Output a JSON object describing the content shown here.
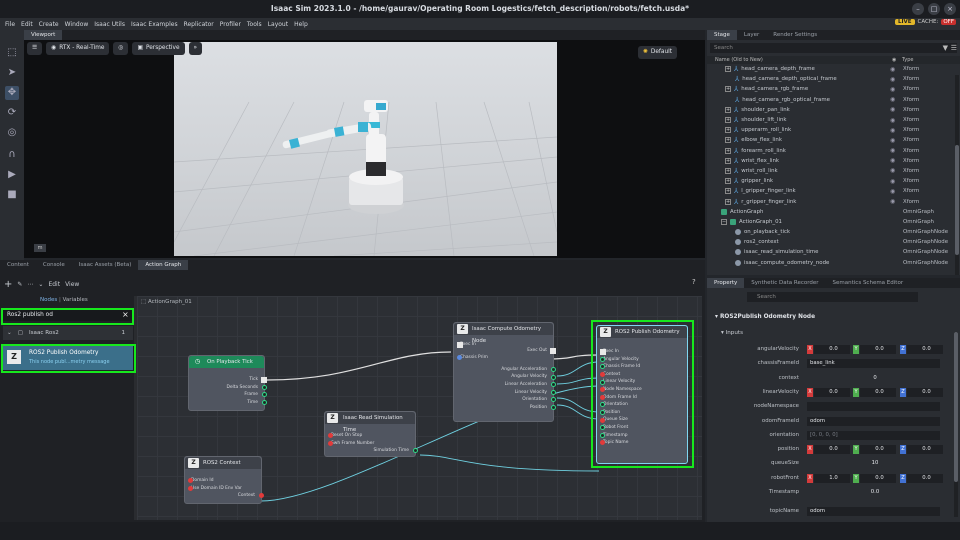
{
  "window": {
    "title": "Isaac Sim 2023.1.0 - /home/gaurav/Operating Room Logestics/fetch_description/robots/fetch.usda*"
  },
  "menu": [
    "File",
    "Edit",
    "Create",
    "Window",
    "Isaac Utils",
    "Isaac Examples",
    "Replicator",
    "Profiler",
    "Tools",
    "Layout",
    "Help"
  ],
  "status": {
    "live": "LIVE",
    "cache_label": "CACHE:",
    "cache_value": "OFF"
  },
  "viewport": {
    "tab": "Viewport",
    "renderer": "RTX - Real-Time",
    "camera": "Perspective",
    "lighting": "Default",
    "badge": "m"
  },
  "stage": {
    "tabs": [
      "Stage",
      "Layer",
      "Render Settings"
    ],
    "search_placeholder": "Search",
    "col_name": "Name (Old to New)",
    "col_type": "Type",
    "rows": [
      {
        "name": "head_camera_depth_frame",
        "type": "Xform",
        "kind": "xf",
        "exp": true,
        "eye": true,
        "indent": 0
      },
      {
        "name": "head_camera_depth_optical_frame",
        "type": "Xform",
        "kind": "xf",
        "exp": false,
        "eye": true,
        "indent": 1
      },
      {
        "name": "head_camera_rgb_frame",
        "type": "Xform",
        "kind": "xf",
        "exp": true,
        "eye": true,
        "indent": 0
      },
      {
        "name": "head_camera_rgb_optical_frame",
        "type": "Xform",
        "kind": "xf",
        "exp": false,
        "eye": true,
        "indent": 1
      },
      {
        "name": "shoulder_pan_link",
        "type": "Xform",
        "kind": "xf",
        "exp": true,
        "eye": true,
        "indent": 0
      },
      {
        "name": "shoulder_lift_link",
        "type": "Xform",
        "kind": "xf",
        "exp": true,
        "eye": true,
        "indent": 0
      },
      {
        "name": "upperarm_roll_link",
        "type": "Xform",
        "kind": "xf",
        "exp": true,
        "eye": true,
        "indent": 0
      },
      {
        "name": "elbow_flex_link",
        "type": "Xform",
        "kind": "xf",
        "exp": true,
        "eye": true,
        "indent": 0
      },
      {
        "name": "forearm_roll_link",
        "type": "Xform",
        "kind": "xf",
        "exp": true,
        "eye": true,
        "indent": 0
      },
      {
        "name": "wrist_flex_link",
        "type": "Xform",
        "kind": "xf",
        "exp": true,
        "eye": true,
        "indent": 0
      },
      {
        "name": "wrist_roll_link",
        "type": "Xform",
        "kind": "xf",
        "exp": true,
        "eye": true,
        "indent": 0
      },
      {
        "name": "gripper_link",
        "type": "Xform",
        "kind": "xf",
        "exp": true,
        "eye": true,
        "indent": 0
      },
      {
        "name": "l_gripper_finger_link",
        "type": "Xform",
        "kind": "xf",
        "exp": true,
        "eye": true,
        "indent": 0
      },
      {
        "name": "r_gripper_finger_link",
        "type": "Xform",
        "kind": "xf",
        "exp": true,
        "eye": true,
        "indent": 0
      },
      {
        "name": "ActionGraph",
        "type": "OmniGraph",
        "kind": "gr",
        "exp": false,
        "eye": false,
        "indent": -1
      },
      {
        "name": "ActionGraph_01",
        "type": "OmniGraph",
        "kind": "gr",
        "exp": true,
        "eye": false,
        "indent": -1
      },
      {
        "name": "on_playback_tick",
        "type": "OmniGraphNode",
        "kind": "nd",
        "exp": false,
        "eye": false,
        "indent": 1
      },
      {
        "name": "ros2_context",
        "type": "OmniGraphNode",
        "kind": "nd",
        "exp": false,
        "eye": false,
        "indent": 1
      },
      {
        "name": "isaac_read_simulation_time",
        "type": "OmniGraphNode",
        "kind": "nd",
        "exp": false,
        "eye": false,
        "indent": 1
      },
      {
        "name": "isaac_compute_odometry_node",
        "type": "OmniGraphNode",
        "kind": "nd",
        "exp": false,
        "eye": false,
        "indent": 1
      }
    ]
  },
  "bottom": {
    "tabs": [
      "Content",
      "Console",
      "Isaac Assets (Beta)",
      "Action Graph"
    ],
    "toolbar": {
      "edit": "Edit",
      "view": "View",
      "help": "?"
    },
    "nodes_tab": "Nodes",
    "variables_tab": "Variables",
    "search_value": "Ros2 publish od",
    "category": "Isaac Ros2",
    "category_count": "1",
    "result_title": "ROS2 Publish Odometry",
    "result_desc": "This node publ...metry message",
    "graph_name": "ActionGraph_01"
  },
  "nodes": {
    "tick": {
      "title": "On Playback Tick",
      "ports": [
        "Tick",
        "Delta Seconds",
        "Frame",
        "Time"
      ]
    },
    "context": {
      "title": "ROS2 Context",
      "inputs": [
        "Domain Id",
        "Use Domain ID Env Var"
      ],
      "outputs": [
        "Context"
      ]
    },
    "simtime": {
      "title": "Isaac Read Simulation Time",
      "inputs": [
        "Reset On Stop",
        "Swh Frame Number"
      ],
      "outputs": [
        "Simulation Time"
      ]
    },
    "odom": {
      "title": "Isaac Compute Odometry Node",
      "inputs": [
        "Exec In",
        "Chassis Prim"
      ],
      "outputs": [
        "Exec Out",
        "Angular Acceleration",
        "Angular Velocity",
        "Linear Acceleration",
        "Linear Velocity",
        "Orientation",
        "Position"
      ]
    },
    "publish": {
      "title": "ROS2 Publish Odometry",
      "inputs": [
        "Exec In",
        "Angular Velocity",
        "Chassis Frame Id",
        "Context",
        "Linear Velocity",
        "Node Namespace",
        "Odom Frame Id",
        "Orientation",
        "Position",
        "Queue Size",
        "Robot Front",
        "Timestamp",
        "Topic Name"
      ]
    }
  },
  "property": {
    "tabs": [
      "Property",
      "Synthetic Data Recorder",
      "Semantics Schema Editor"
    ],
    "search_placeholder": "Search",
    "section": "ROS2Publish Odometry Node",
    "subsection": "Inputs",
    "angularVelocity": {
      "label": "angularVelocity",
      "x": "0.0",
      "y": "0.0",
      "z": "0.0"
    },
    "chassisFrameId": {
      "label": "chassisFrameId",
      "value": "base_link"
    },
    "context": {
      "label": "context",
      "value": "0"
    },
    "linearVelocity": {
      "label": "linearVelocity",
      "x": "0.0",
      "y": "0.0",
      "z": "0.0"
    },
    "nodeNamespace": {
      "label": "nodeNamespace",
      "value": ""
    },
    "odomFrameId": {
      "label": "odomFrameId",
      "value": "odom"
    },
    "orientation": {
      "label": "orientation",
      "value": "[0, 0, 0, 0]"
    },
    "position": {
      "label": "position",
      "x": "0.0",
      "y": "0.0",
      "z": "0.0"
    },
    "queueSize": {
      "label": "queueSize",
      "value": "10"
    },
    "robotFront": {
      "label": "robotFront",
      "x": "1.0",
      "y": "0.0",
      "z": "0.0"
    },
    "timestamp": {
      "label": "Timestamp",
      "value": "0.0"
    },
    "topicName": {
      "label": "topicName",
      "value": "odom"
    }
  },
  "colors": {
    "highlight": "#17e81d",
    "x": "#d43b3b",
    "y": "#4fae4f",
    "z": "#4272d4"
  }
}
